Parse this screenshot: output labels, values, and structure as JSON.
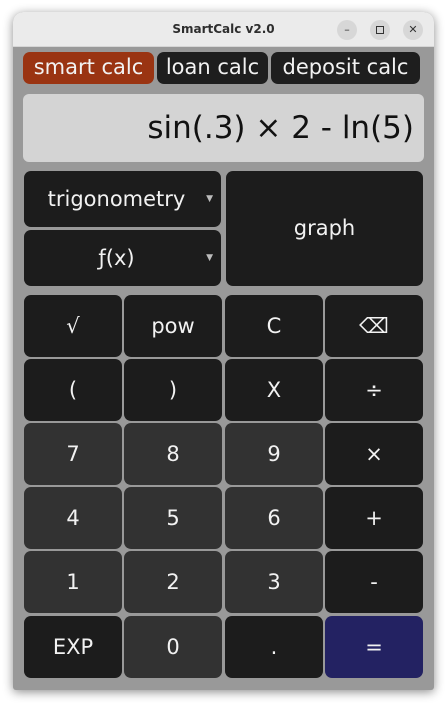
{
  "window": {
    "title": "SmartCalc v2.0",
    "controls": {
      "minimize": "–",
      "close": "✕"
    }
  },
  "tabs": [
    {
      "label": "smart calc",
      "active": true
    },
    {
      "label": "loan calc",
      "active": false
    },
    {
      "label": "deposit calc",
      "active": false
    }
  ],
  "display": {
    "expression": "sin(.3) × 2 - ln(5)"
  },
  "selects": {
    "category": {
      "value": "trigonometry",
      "arrow": "▼"
    },
    "function": {
      "value": "ƒ(x)",
      "arrow": "▼"
    }
  },
  "graph_label": "graph",
  "keypad": {
    "row1": [
      "√",
      "pow",
      "C",
      "⌫"
    ],
    "row2": [
      "(",
      ")",
      "X",
      "÷"
    ],
    "row3": [
      "7",
      "8",
      "9",
      "×"
    ],
    "row4": [
      "4",
      "5",
      "6",
      "+"
    ],
    "row5": [
      "1",
      "2",
      "3",
      "-"
    ],
    "row6": [
      "EXP",
      "0",
      ".",
      "="
    ]
  },
  "colors": {
    "active_tab": "#9a3412",
    "equals_key": "#232262",
    "display_bg": "#d4d4d4",
    "key_dark": "#1c1c1c",
    "key_number": "#323232"
  }
}
